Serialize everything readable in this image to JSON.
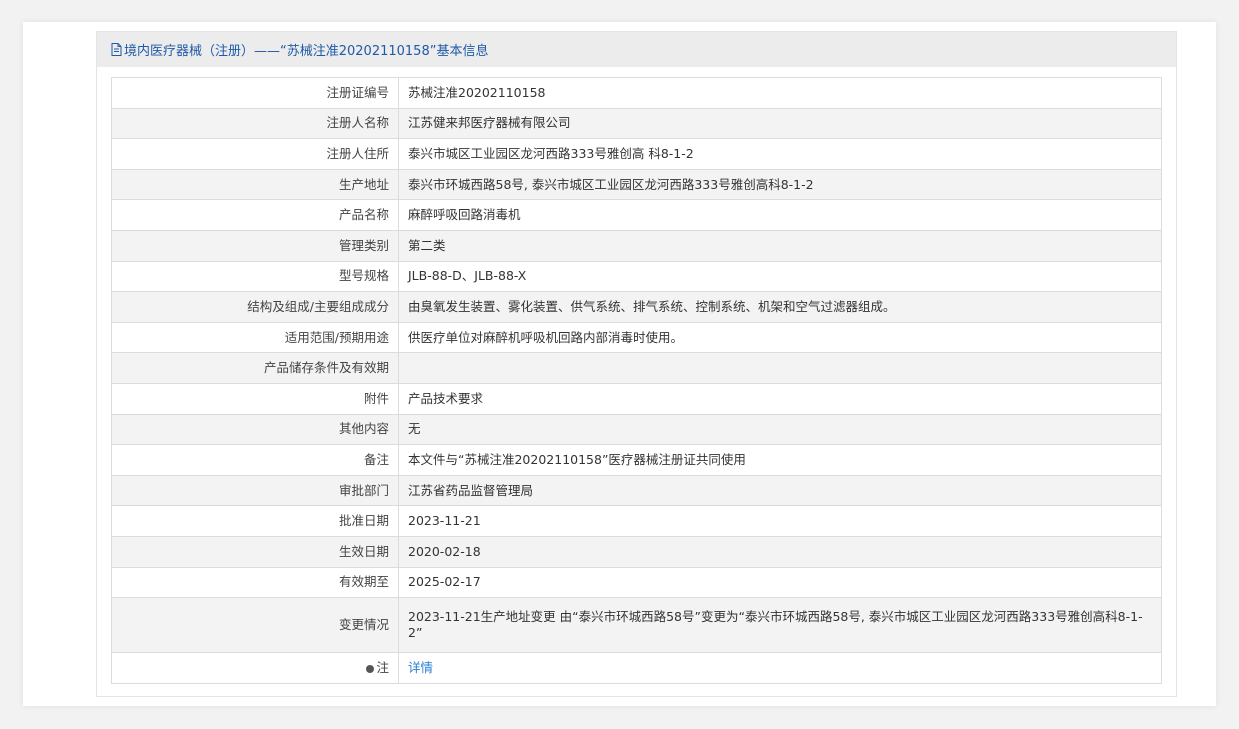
{
  "header": {
    "title": "境内医疗器械（注册）——“苏械注准20202110158”基本信息"
  },
  "rows": [
    {
      "label": "注册证编号",
      "value": "苏械注准20202110158"
    },
    {
      "label": "注册人名称",
      "value": "江苏健来邦医疗器械有限公司"
    },
    {
      "label": "注册人住所",
      "value": "泰兴市城区工业园区龙河西路333号雅创高 科8-1-2"
    },
    {
      "label": "生产地址",
      "value": "泰兴市环城西路58号, 泰兴市城区工业园区龙河西路333号雅创高科8-1-2"
    },
    {
      "label": "产品名称",
      "value": "麻醉呼吸回路消毒机"
    },
    {
      "label": "管理类别",
      "value": "第二类"
    },
    {
      "label": "型号规格",
      "value": "JLB-88-D、JLB-88-X"
    },
    {
      "label": "结构及组成/主要组成成分",
      "value": "由臭氧发生装置、雾化装置、供气系统、排气系统、控制系统、机架和空气过滤器组成。"
    },
    {
      "label": "适用范围/预期用途",
      "value": "供医疗单位对麻醉机呼吸机回路内部消毒时使用。"
    },
    {
      "label": "产品储存条件及有效期",
      "value": ""
    },
    {
      "label": "附件",
      "value": "产品技术要求"
    },
    {
      "label": "其他内容",
      "value": "无"
    },
    {
      "label": "备注",
      "value": "本文件与“苏械注准20202110158”医疗器械注册证共同使用"
    },
    {
      "label": "审批部门",
      "value": "江苏省药品监督管理局"
    },
    {
      "label": "批准日期",
      "value": "2023-11-21"
    },
    {
      "label": "生效日期",
      "value": "2020-02-18"
    },
    {
      "label": "有效期至",
      "value": "2025-02-17"
    },
    {
      "label": "变更情况",
      "value": "2023-11-21生产地址变更 由“泰兴市环城西路58号”变更为“泰兴市环城西路58号, 泰兴市城区工业园区龙河西路333号雅创高科8-1-2”"
    }
  ],
  "note": {
    "label": "注",
    "link": "详情"
  }
}
